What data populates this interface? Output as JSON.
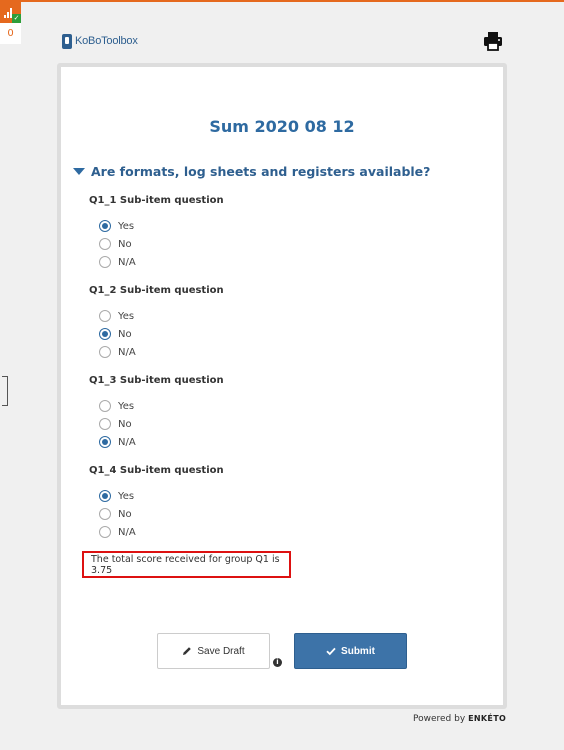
{
  "header": {
    "logo_text": "KoBoToolbox",
    "queue_count": "0"
  },
  "form": {
    "title": "Sum 2020 08 12",
    "group_label": "Are formats, log sheets and registers available?",
    "questions": [
      {
        "label": "Q1_1 Sub-item question",
        "options": [
          "Yes",
          "No",
          "N/A"
        ],
        "selected": "Yes"
      },
      {
        "label": "Q1_2 Sub-item question",
        "options": [
          "Yes",
          "No",
          "N/A"
        ],
        "selected": "No"
      },
      {
        "label": "Q1_3 Sub-item question",
        "options": [
          "Yes",
          "No",
          "N/A"
        ],
        "selected": "N/A"
      },
      {
        "label": "Q1_4 Sub-item question",
        "options": [
          "Yes",
          "No",
          "N/A"
        ],
        "selected": "Yes"
      }
    ],
    "score_note": "The total score received for group Q1 is 3.75"
  },
  "actions": {
    "save_draft_label": "Save Draft",
    "submit_label": "Submit"
  },
  "footer": {
    "powered_by": "Powered by",
    "brand": "ENKÉTO"
  },
  "colors": {
    "accent": "#2e6aa1",
    "submit_bg": "#3d73a8",
    "top_bar": "#e5691e",
    "highlight_border": "#dd1111"
  }
}
